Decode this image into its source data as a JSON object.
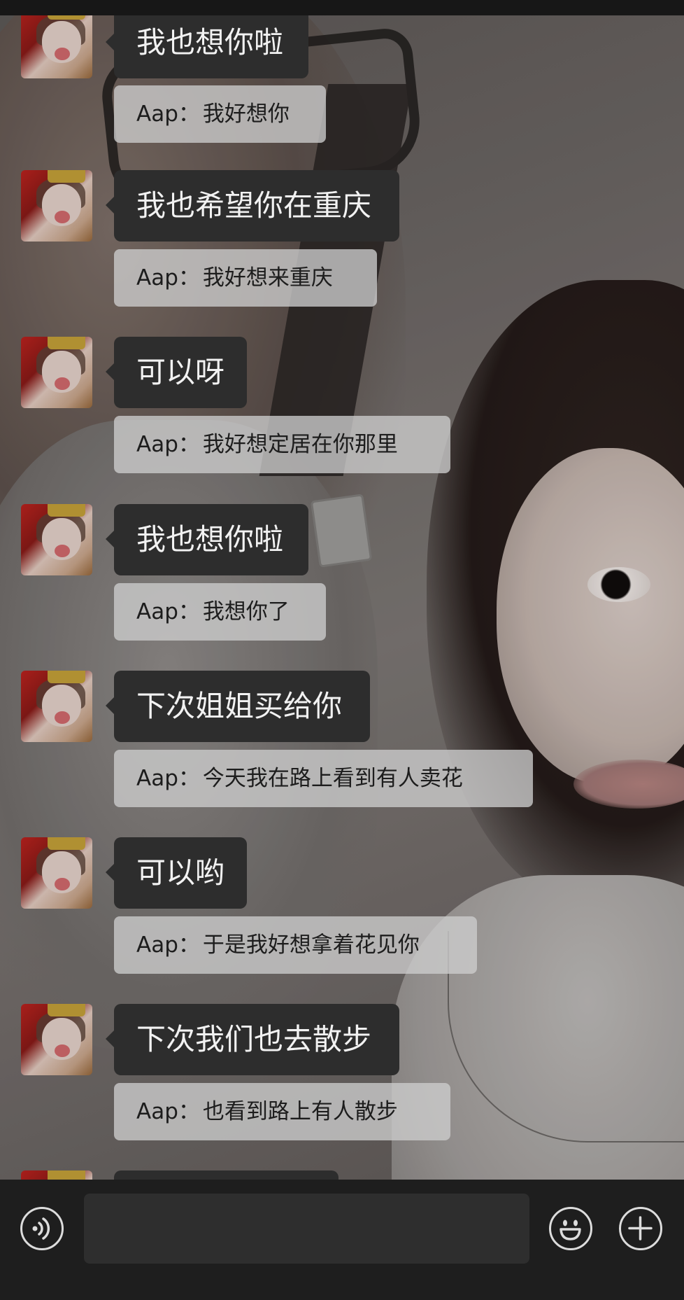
{
  "conversation": [
    {
      "reply": "我也想你啦",
      "quote_sender": "Aap：",
      "quote_text": "我好想你"
    },
    {
      "reply": "我也希望你在重庆",
      "quote_sender": "Aap：",
      "quote_text": "我好想来重庆"
    },
    {
      "reply": "可以呀",
      "quote_sender": "Aap：",
      "quote_text": "我好想定居在你那里"
    },
    {
      "reply": "我也想你啦",
      "quote_sender": "Aap：",
      "quote_text": "我想你了"
    },
    {
      "reply": "下次姐姐买给你",
      "quote_sender": "Aap：",
      "quote_text": "今天我在路上看到有人卖花"
    },
    {
      "reply": "可以哟",
      "quote_sender": "Aap：",
      "quote_text": "于是我好想拿着花见你"
    },
    {
      "reply": "下次我们也去散步",
      "quote_sender": "Aap：",
      "quote_text": "也看到路上有人散步"
    }
  ],
  "input_bar": {
    "voice_icon": "voice-icon",
    "emoji_icon": "emoji-icon",
    "plus_icon": "plus-icon",
    "text_value": ""
  },
  "colors": {
    "bubble_dark": "#2d2d2d",
    "quote_bg": "#cdcdcd",
    "input_bar_bg": "#1e1e1e"
  }
}
